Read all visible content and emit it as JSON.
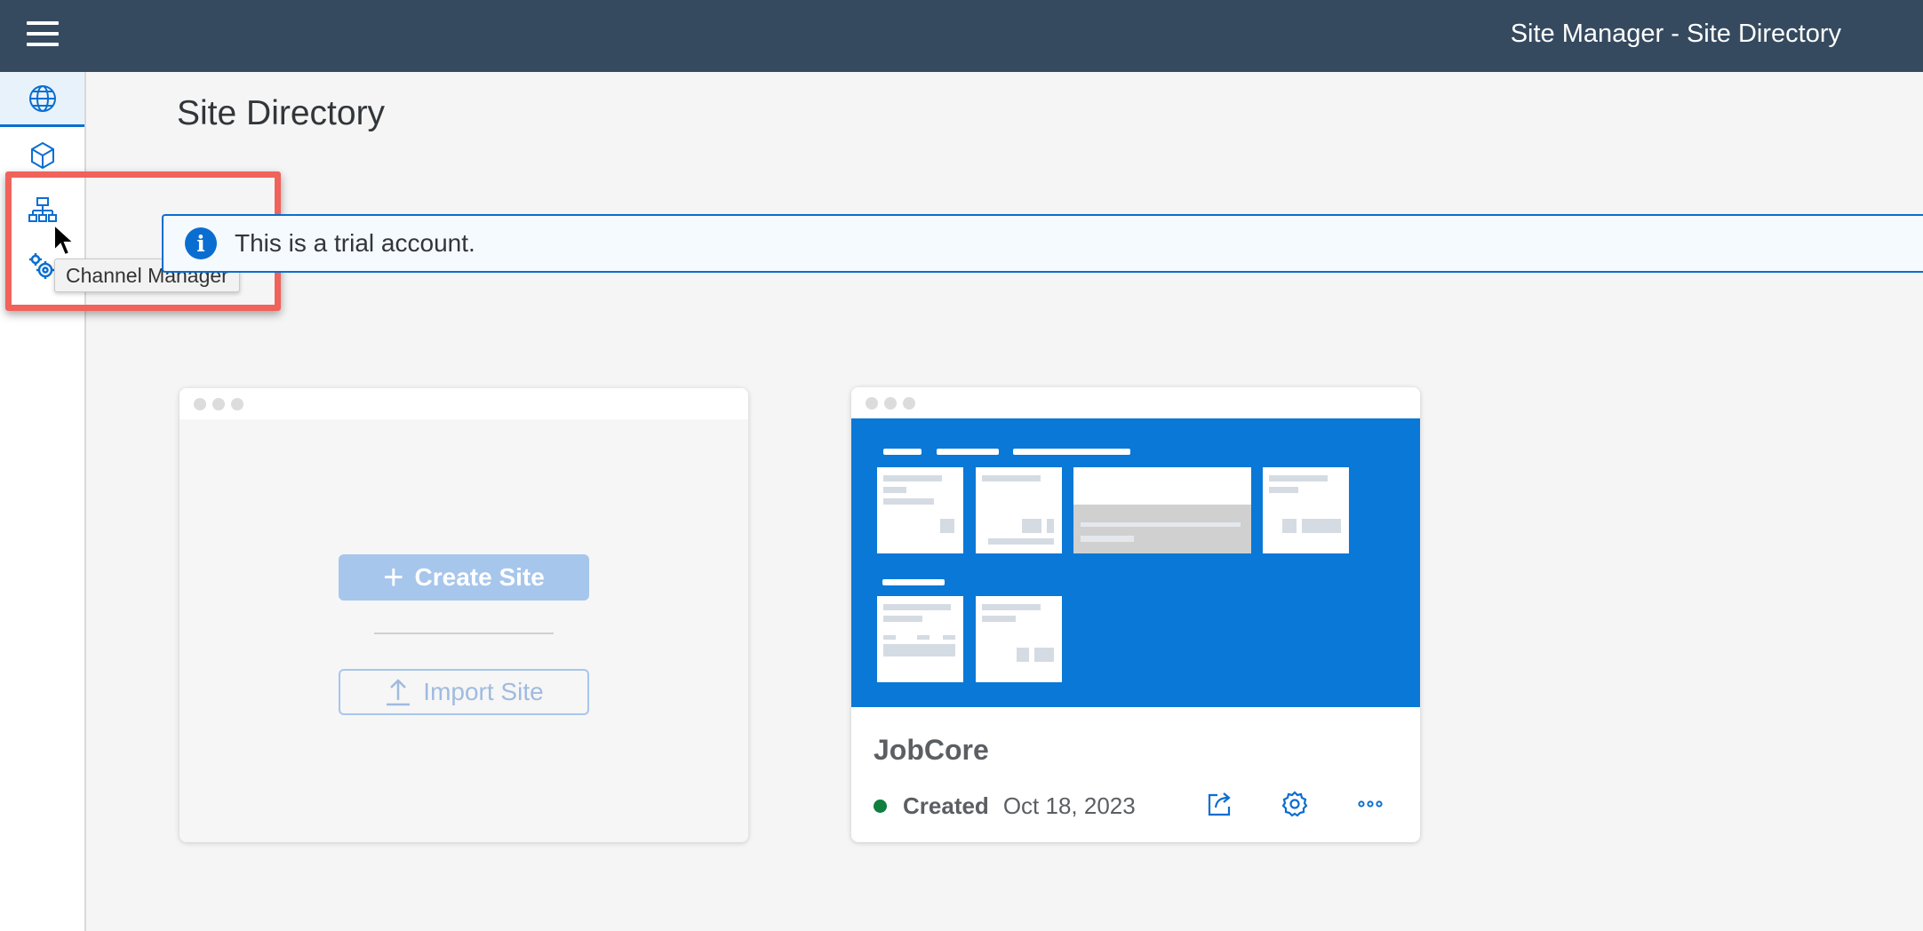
{
  "shellbar": {
    "title": "Site Manager - Site Directory",
    "menu_icon": "hamburger-icon"
  },
  "sidenav": {
    "items": [
      {
        "name": "site-directory",
        "icon": "globe-icon",
        "active": true
      },
      {
        "name": "content-manager",
        "icon": "cube-icon",
        "active": false
      },
      {
        "name": "channel-manager",
        "icon": "org-chart-icon",
        "active": false
      },
      {
        "name": "settings",
        "icon": "gears-icon",
        "active": false
      }
    ],
    "tooltip": "Channel Manager"
  },
  "main": {
    "title": "Site Directory",
    "message_strip": {
      "text": "This is a trial account.",
      "icon": "info-icon"
    },
    "create_card": {
      "create_label": "Create Site",
      "import_label": "Import Site"
    },
    "site_card": {
      "name": "JobCore",
      "status": "Created",
      "date": "Oct 18, 2023",
      "actions": [
        "share-icon",
        "settings-icon",
        "more-icon"
      ]
    }
  },
  "colors": {
    "shellbar": "#354a5f",
    "accent": "#0a6ed1",
    "highlight": "#f0625a",
    "status_ok": "#107e3e",
    "preview_bg": "#0a78d6"
  }
}
